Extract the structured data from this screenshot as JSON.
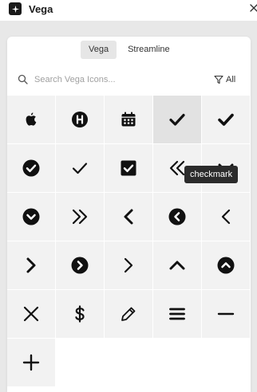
{
  "window": {
    "title": "Vega"
  },
  "tabs": [
    {
      "label": "Vega",
      "active": true
    },
    {
      "label": "Streamline",
      "active": false
    }
  ],
  "search": {
    "placeholder": "Search Vega Icons...",
    "value": ""
  },
  "filter": {
    "label": "All"
  },
  "tooltip": {
    "text": "checkmark"
  },
  "icons": [
    "apple-icon",
    "hotel-circle-icon",
    "calendar-icon",
    "checkmark-icon",
    "checkmark-bold-icon",
    "checkmark-circle-icon",
    "checkmark-thin-icon",
    "checkbox-checked-icon",
    "chevrons-left-icon",
    "chevron-down-icon",
    "chevron-down-circle-icon",
    "chevrons-right-icon",
    "chevron-left-icon",
    "chevron-left-circle-icon",
    "chevron-left-thin-icon",
    "chevron-right-icon",
    "chevron-right-circle-icon",
    "chevron-right-thin-icon",
    "chevron-up-icon",
    "chevron-up-circle-icon",
    "close-icon",
    "dollar-icon",
    "pencil-icon",
    "menu-icon",
    "minus-icon",
    "plus-icon"
  ],
  "hovered_icon_index": 3,
  "colors": {
    "icon": "#111111",
    "cell": "#f2f2f2",
    "cell_hover": "#e2e2e2",
    "tooltip_bg": "#2b2b2b"
  }
}
